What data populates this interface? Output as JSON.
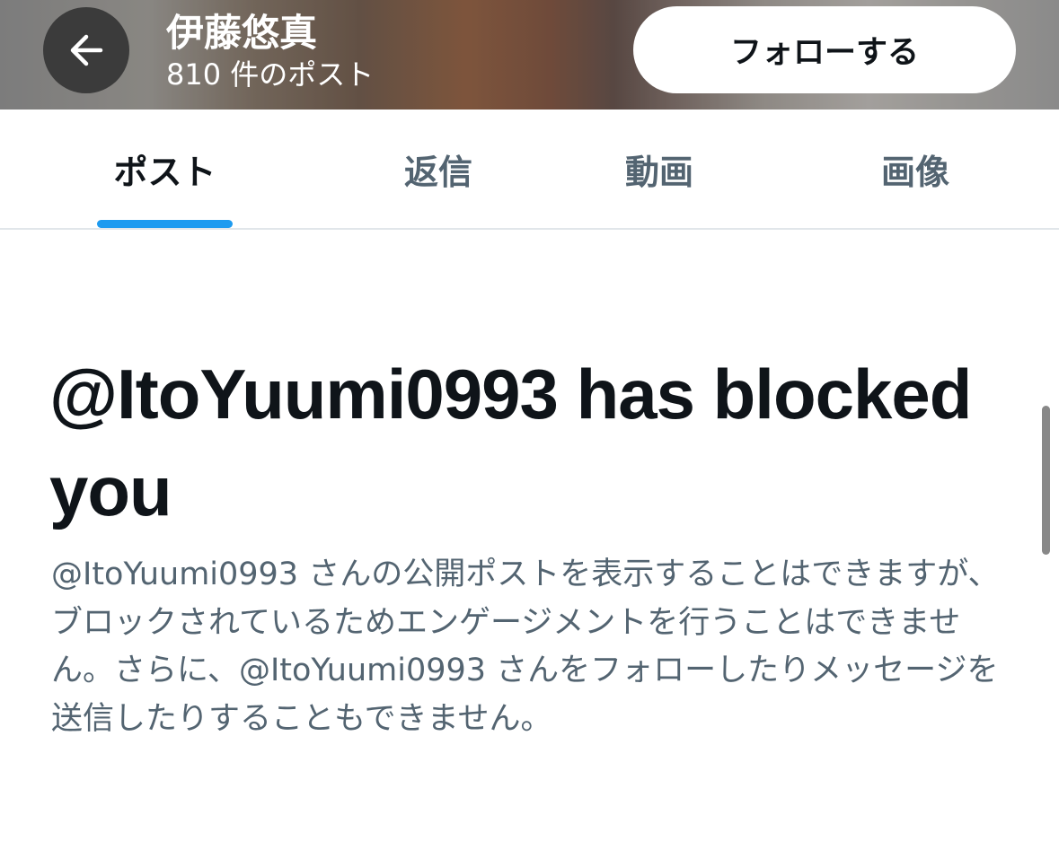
{
  "header": {
    "back_icon": "arrow-left-icon",
    "display_name": "伊藤悠真",
    "post_count": "810 件のポスト",
    "follow_label": "フォローする"
  },
  "tabs": [
    {
      "label": "ポスト",
      "active": true
    },
    {
      "label": "返信",
      "active": false
    },
    {
      "label": "動画",
      "active": false
    },
    {
      "label": "画像",
      "active": false
    }
  ],
  "blocked": {
    "title": "@ItoYuumi0993 has blocked you",
    "description": "@ItoYuumi0993 さんの公開ポストを表示することはできますが、ブロックされているためエンゲージメントを行うことはできません。さらに、@ItoYuumi0993 さんをフォローしたりメッセージを送信したりすることもできません。"
  },
  "colors": {
    "accent": "#1d9bf0",
    "primary_text": "#0f1419",
    "secondary_text": "#536471"
  }
}
